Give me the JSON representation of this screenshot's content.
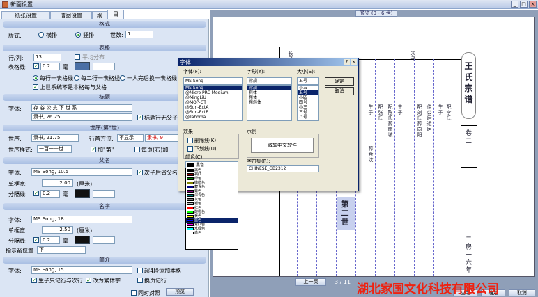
{
  "window": {
    "title": "新面设置",
    "btn_min": "_",
    "btn_max": "□",
    "btn_close": "×"
  },
  "tabs": [
    "纸张设置",
    "谱图设置",
    "纲",
    "目"
  ],
  "style": {
    "header": "格式",
    "label": "版式:",
    "opt1": "横排",
    "opt2": "竖排",
    "gen_label": "世数:",
    "gen_value": "1"
  },
  "table": {
    "header": "表格",
    "rowcol_label": "行/列:",
    "rowcol_value": "13",
    "avg_label": "平均分布",
    "border_label": "表格线:",
    "border_value": "0.2",
    "unit": "毫",
    "each_one": "每行一表格线",
    "each_two": "每二行一表格线",
    "one_person": "一人完后换一表格线",
    "new_page": "上世系统不是本格每与父格"
  },
  "title": {
    "header": "标题",
    "font_label": "字体:",
    "text_value": "存 谷 公 支 下 世 系",
    "font_value": "隶书, 26.25",
    "center_label": "标题行无父子关系"
  },
  "gen": {
    "header": "世序(第*世)",
    "font_label": "世序:",
    "font_value": "隶书, 21.75",
    "align_label": "行首方位:",
    "align_value": "不显示",
    "color_label": "隶书, 9",
    "style_label": "世序样式:",
    "style_value": "一百一十世",
    "add_label": "加\"第\"",
    "every_label": "每页(右)加"
  },
  "father": {
    "header": "父名",
    "font_label": "字体:",
    "font_value": "MS Song, 10.5",
    "width_label": "单框宽:",
    "width_value": "2.00",
    "unit": "(厘米)",
    "next_label": "次子后省父名",
    "line_label": "分隔线:",
    "line_value": "0.2",
    "line_unit": "毫"
  },
  "name": {
    "header": "名字",
    "font_label": "字体:",
    "font_value": "MS Song, 18",
    "width_label": "单框宽:",
    "width_value": "2.50",
    "unit": "(厘米)",
    "line_label": "分隔线:",
    "line_value": "0.2",
    "line_unit": "毫",
    "pos_label": "指示箭位置:",
    "pos_value": "下"
  },
  "brief": {
    "header": "简介",
    "font_label": "字体:",
    "font_value": "MS Song, 15",
    "cb1": "超4段添加本格",
    "cb2": "生子只记行与次行",
    "cb3": "改为繁体字",
    "cb4": "换页记行"
  },
  "bottom": {
    "cb": "同时对照",
    "btn": "预览"
  },
  "preview": {
    "page_info": "预览 (0 - 6 世)",
    "prev": "上一页",
    "counter": "3 / 11",
    "next": "下一页",
    "right1": "应用",
    "right2": "确定",
    "right3": "取消"
  },
  "font_dialog": {
    "title": "字体",
    "font_label": "字体(F):",
    "font_value": "MS Song",
    "fonts": [
      "MS Song",
      "@Micro PRC Medium",
      "@MingLiU",
      "@MOP-GT",
      "@Sun-ExtA",
      "@Sun-ExtB",
      "@Tahoma"
    ],
    "style_label": "字形(Y):",
    "style_value": "常规",
    "styles": [
      "常规",
      "斜体",
      "粗体",
      "粗斜体"
    ],
    "size_label": "大小(S):",
    "size_value": "五号",
    "sizes": [
      "小五",
      "五号",
      "小四",
      "四号",
      "小三",
      "三号",
      "二号",
      "小二",
      "八号"
    ],
    "ok": "确定",
    "cancel": "取消",
    "effects_label": "效果",
    "strike": "删除线(K)",
    "underline": "下划线(U)",
    "color_label": "颜色(C):",
    "color_value": "黑色",
    "sample_label": "示例",
    "sample_text": "微软中文软件",
    "charset_label": "字符集(R):",
    "charset_value": "CHINESE_GB2312"
  },
  "colors": [
    {
      "name": "黑色",
      "hex": "#000000"
    },
    {
      "name": "褐红",
      "hex": "#800000"
    },
    {
      "name": "绿色",
      "hex": "#008000"
    },
    {
      "name": "橄榄色",
      "hex": "#808000"
    },
    {
      "name": "藏青色",
      "hex": "#000080"
    },
    {
      "name": "紫色",
      "hex": "#800080"
    },
    {
      "name": "深青色",
      "hex": "#008080"
    },
    {
      "name": "灰色",
      "hex": "#808080"
    },
    {
      "name": "银色",
      "hex": "#C0C0C0"
    },
    {
      "name": "红色",
      "hex": "#FF0000"
    },
    {
      "name": "酸橙色",
      "hex": "#00FF00"
    },
    {
      "name": "黄色",
      "hex": "#FFFF00"
    },
    {
      "name": "蓝色",
      "hex": "#0000FF"
    },
    {
      "name": "紫红色",
      "hex": "#FF00FF"
    },
    {
      "name": "水绿色",
      "hex": "#00FFFF"
    },
    {
      "name": "白色",
      "hex": "#FFFFFF"
    }
  ],
  "preview_page": {
    "col1": "王氏宗谱",
    "col2": "卷二",
    "col3": "二房一六年",
    "gen_mark": "第二世",
    "chars": [
      "生子一",
      "配张氏",
      "长子",
      "生子一",
      "佳公后迁居",
      "配刘氏 葬向阳",
      "配陈氏 葬南坡",
      "次子",
      "生子一",
      "配李氏",
      "葬合坟"
    ]
  },
  "company": "湖北家国文化科技有限公司"
}
